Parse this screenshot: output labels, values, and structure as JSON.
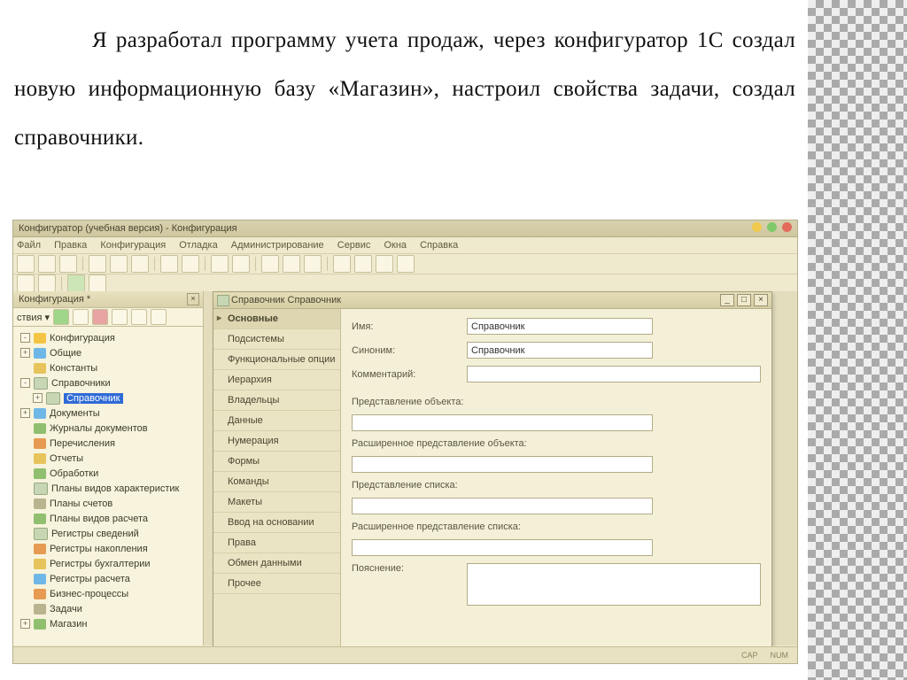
{
  "paragraph": "Я разработал программу учета продаж, через конфигуратор 1С создал новую информационную базу «Магазин», настроил свойства задачи, создал справочники.",
  "app": {
    "title": "Конфигуратор (учебная версия) - Конфигурация",
    "menu": [
      "Файл",
      "Правка",
      "Конфигурация",
      "Отладка",
      "Администрирование",
      "Сервис",
      "Окна",
      "Справка"
    ]
  },
  "leftpanel": {
    "title": "Конфигурация *",
    "tabsLabel": "ствия ▾",
    "tree": {
      "root": "Конфигурация",
      "items": [
        {
          "icon": "ic-blue",
          "label": "Общие",
          "exp": "+"
        },
        {
          "icon": "ic-yel",
          "label": "Константы"
        },
        {
          "icon": "ic-tbl",
          "label": "Справочники",
          "exp": "-"
        },
        {
          "icon": "ic-tbl",
          "label": "Справочник",
          "sub": true,
          "sel": true,
          "exp": "+"
        },
        {
          "icon": "ic-blue",
          "label": "Документы",
          "exp": "+"
        },
        {
          "icon": "ic-grn",
          "label": "Журналы документов"
        },
        {
          "icon": "ic-org",
          "label": "Перечисления"
        },
        {
          "icon": "ic-yel",
          "label": "Отчеты"
        },
        {
          "icon": "ic-grn",
          "label": "Обработки"
        },
        {
          "icon": "ic-tbl",
          "label": "Планы видов характеристик"
        },
        {
          "icon": "ic-gry",
          "label": "Планы счетов"
        },
        {
          "icon": "ic-grn",
          "label": "Планы видов расчета"
        },
        {
          "icon": "ic-tbl",
          "label": "Регистры сведений"
        },
        {
          "icon": "ic-org",
          "label": "Регистры накопления"
        },
        {
          "icon": "ic-yel",
          "label": "Регистры бухгалтерии"
        },
        {
          "icon": "ic-blue",
          "label": "Регистры расчета"
        },
        {
          "icon": "ic-org",
          "label": "Бизнес-процессы"
        },
        {
          "icon": "ic-gry",
          "label": "Задачи"
        },
        {
          "icon": "ic-grn",
          "label": "Магазин",
          "exp": "+"
        }
      ]
    },
    "taskTab": "Справочник Справочник"
  },
  "propwin": {
    "title": "Справочник Справочник",
    "tabs": [
      "Основные",
      "Подсистемы",
      "Функциональные опции",
      "Иерархия",
      "Владельцы",
      "Данные",
      "Нумерация",
      "Формы",
      "Команды",
      "Макеты",
      "Ввод на основании",
      "Права",
      "Обмен данными",
      "Прочее"
    ],
    "activeTab": 0,
    "fields": {
      "name_label": "Имя:",
      "name_value": "Справочник",
      "syn_label": "Синоним:",
      "syn_value": "Справочник",
      "comment_label": "Комментарий:",
      "comment_value": "",
      "objrep_label": "Представление объекта:",
      "objrep_value": "",
      "extobjrep_label": "Расширенное представление объекта:",
      "extobjrep_value": "",
      "listrep_label": "Представление списка:",
      "listrep_value": "",
      "extlistrep_label": "Расширенное представление списка:",
      "extlistrep_value": "",
      "explain_label": "Пояснение:"
    }
  },
  "status": {
    "cap": "CAP",
    "num": "NUM"
  }
}
